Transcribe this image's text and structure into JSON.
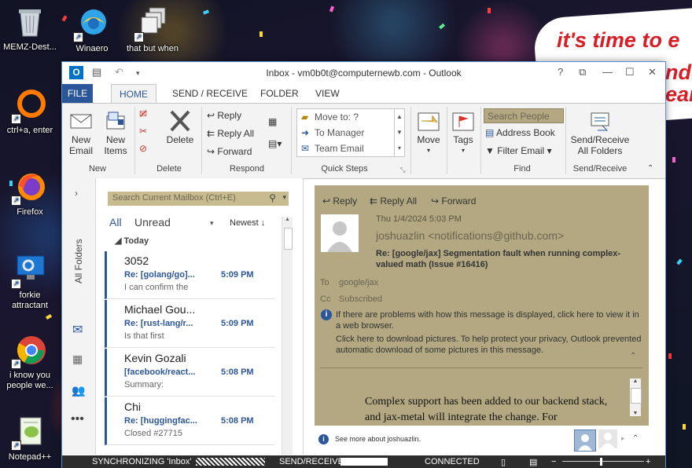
{
  "desktop": {
    "icons": [
      {
        "label": "MEMZ-Dest..."
      },
      {
        "label": "Winaero"
      },
      {
        "label": "that but when"
      },
      {
        "label": "ctrl+a, enter"
      },
      {
        "label": "Firefox"
      },
      {
        "label": "forkie attractant"
      },
      {
        "label": "i know you people we..."
      },
      {
        "label": "Notepad++"
      }
    ],
    "banner_line1": "it's time to e",
    "banner_line2": "nde",
    "banner_line3": "ear"
  },
  "window": {
    "title": "Inbox - vm0b0t@computernewb.com - Outlook",
    "controls": {
      "help": "?",
      "restore": "⧉",
      "minimize": "—",
      "maximize": "☐",
      "close": "✕"
    }
  },
  "ribbon": {
    "tabs": [
      "FILE",
      "HOME",
      "SEND / RECEIVE",
      "FOLDER",
      "VIEW"
    ],
    "groups": {
      "new": {
        "label": "New",
        "new_email": "New Email",
        "new_items": "New Items"
      },
      "delete": {
        "label": "Delete",
        "delete": "Delete"
      },
      "respond": {
        "label": "Respond",
        "reply": "Reply",
        "reply_all": "Reply All",
        "forward": "Forward"
      },
      "quick_steps": {
        "label": "Quick Steps",
        "items": [
          "Move to: ?",
          "To Manager",
          "Team Email"
        ]
      },
      "move": {
        "move": "Move"
      },
      "tags": {
        "tags": "Tags"
      },
      "find": {
        "label": "Find",
        "search_people": "Search People",
        "address_book": "Address Book",
        "filter_email": "Filter Email"
      },
      "send_receive": {
        "label": "Send/Receive",
        "send_receive_all": "Send/Receive All Folders"
      }
    }
  },
  "nav": {
    "all_folders": "All Folders"
  },
  "message_list": {
    "search_placeholder": "Search Current Mailbox (Ctrl+E)",
    "filter_all": "All",
    "filter_unread": "Unread",
    "sort": "Newest",
    "group_today": "Today",
    "messages": [
      {
        "from": "3052",
        "subject": "Re: [golang/go]...",
        "time": "5:09 PM",
        "preview": "I can confirm the"
      },
      {
        "from": "Michael Gou...",
        "subject": "Re: [rust-lang/r...",
        "time": "5:09 PM",
        "preview": "Is that first"
      },
      {
        "from": "Kevin Gozali",
        "subject": "[facebook/react...",
        "time": "5:08 PM",
        "preview": "Summary:"
      },
      {
        "from": "Chi",
        "subject": "Re: [huggingfac...",
        "time": "5:08 PM",
        "preview": "Closed #27715"
      }
    ]
  },
  "reading_pane": {
    "reply": "Reply",
    "reply_all": "Reply All",
    "forward": "Forward",
    "date": "Thu 1/4/2024 5:03 PM",
    "sender": "joshuazlin <notifications@github.com>",
    "subject": "Re: [google/jax] Segmentation fault when running complex-valued math (Issue #16416)",
    "to_label": "To",
    "to": "google/jax",
    "cc_label": "Cc",
    "cc": "Subscribed",
    "info1": "If there are problems with how this message is displayed, click here to view it in a web browser.",
    "info2": "Click here to download pictures. To help protect your privacy, Outlook prevented automatic download of some pictures in this message.",
    "body": "Complex support has been added to our backend stack, and jax-metal will integrate the change. For",
    "see_more": "See more about joshuazlin."
  },
  "status_bar": {
    "sync": "SYNCHRONIZING 'Inbox'",
    "send_receive": "SEND/RECEIVE",
    "connected": "CONNECTED"
  },
  "colors": {
    "accent": "#2b579a",
    "reading_bg": "#b3a882",
    "search_bg": "#c8bb90"
  }
}
